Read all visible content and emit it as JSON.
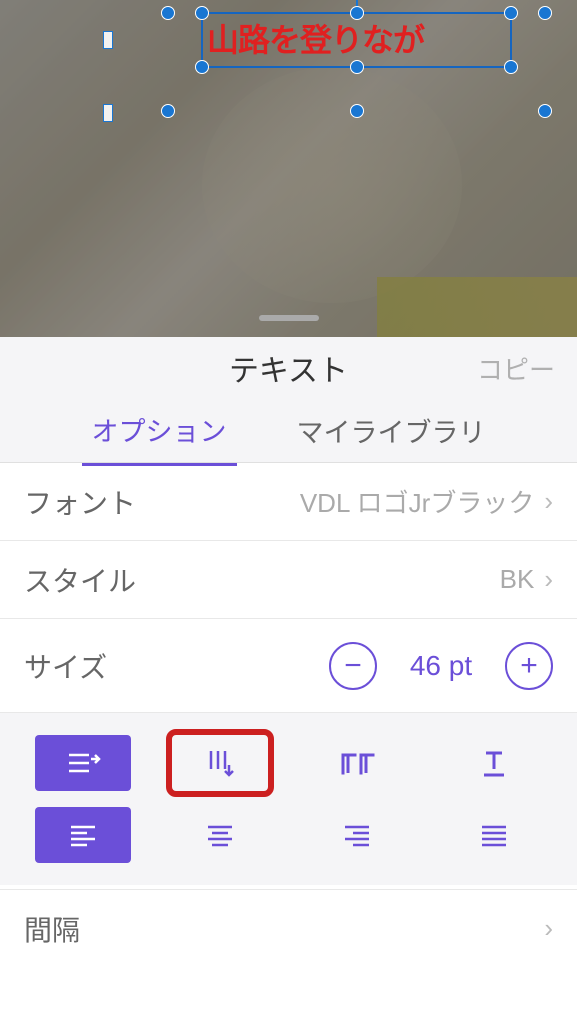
{
  "canvas": {
    "text_content": "山路を登りなが"
  },
  "panel": {
    "title": "テキスト",
    "copy_label": "コピー"
  },
  "tabs": {
    "options": "オプション",
    "library": "マイライブラリ"
  },
  "rows": {
    "font": {
      "label": "フォント",
      "value": "VDL ロゴJrブラック"
    },
    "style": {
      "label": "スタイル",
      "value": "BK"
    },
    "size": {
      "label": "サイズ",
      "value": "46 pt"
    },
    "spacing": {
      "label": "間隔"
    }
  },
  "icons": {
    "minus": "−",
    "plus": "+",
    "chevron": "›"
  }
}
